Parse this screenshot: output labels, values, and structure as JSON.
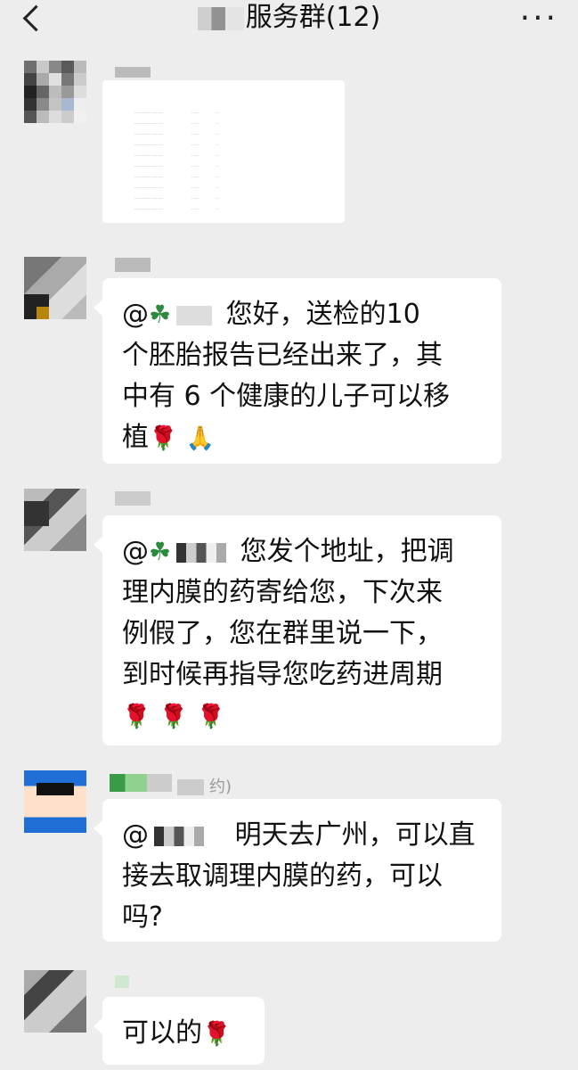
{
  "header": {
    "title": "服务群(12)",
    "back_icon": "chevron-left-icon",
    "more_icon": "more-icon"
  },
  "messages": [
    {
      "type": "image"
    },
    {
      "type": "text",
      "mention": "@",
      "lines": [
        "您好，送检的10",
        "个胚胎报告已经出来了，其",
        "中有 6 个健康的儿子可以移",
        "植"
      ],
      "emojis": [
        "rose",
        "pray"
      ]
    },
    {
      "type": "text",
      "mention": "@",
      "lines": [
        "您发个地址，把调",
        "理内膜的药寄给您，下次来",
        "例假了，您在群里说一下，",
        "到时候再指导您吃药进周期"
      ],
      "emojis": [
        "rose",
        "rose",
        "rose"
      ]
    },
    {
      "type": "text",
      "nick_suffix": "约)",
      "mention": "@",
      "lines": [
        "明天去广州，可以直",
        "接去取调理内膜的药，可以",
        "吗?"
      ]
    },
    {
      "type": "text",
      "lines": [
        "可以的"
      ],
      "emojis": [
        "rose"
      ]
    }
  ]
}
